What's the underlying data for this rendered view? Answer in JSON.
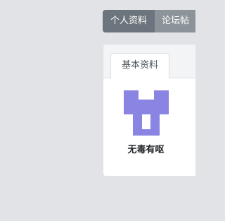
{
  "top_tabs": {
    "profile_label": "个人资料",
    "forum_posts_label": "论坛帖"
  },
  "profile_card": {
    "tab_label": "基本资料",
    "username": "无毒有呕"
  },
  "colors": {
    "avatar_purple": "#8a84e3",
    "tab_active_bg": "#6c757d",
    "tab_inactive_bg": "#8c9399"
  },
  "avatar": {
    "icon": "identicon-avatar"
  }
}
